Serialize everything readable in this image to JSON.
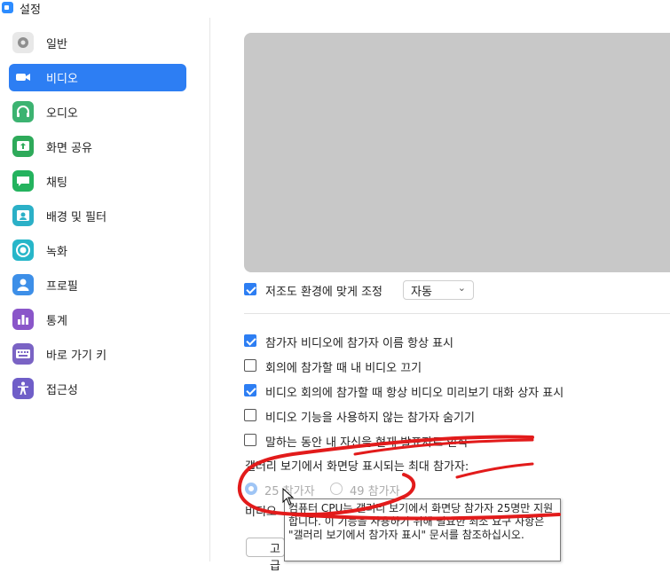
{
  "window": {
    "title": "설정"
  },
  "sidebar": {
    "items": [
      {
        "label": "일반",
        "icon": "gear-icon",
        "color": "#8f8f8f",
        "active": false
      },
      {
        "label": "비디오",
        "icon": "video-camera-icon",
        "color": "#2d7ef3",
        "active": true
      },
      {
        "label": "오디오",
        "icon": "headphones-icon",
        "color": "#3cb371",
        "active": false
      },
      {
        "label": "화면 공유",
        "icon": "share-screen-icon",
        "color": "#2eaa5a",
        "active": false
      },
      {
        "label": "채팅",
        "icon": "chat-icon",
        "color": "#24b35e",
        "active": false
      },
      {
        "label": "배경 및 필터",
        "icon": "background-icon",
        "color": "#2bb0c7",
        "active": false
      },
      {
        "label": "녹화",
        "icon": "record-icon",
        "color": "#27b6c9",
        "active": false
      },
      {
        "label": "프로필",
        "icon": "profile-icon",
        "color": "#3d8fe8",
        "active": false
      },
      {
        "label": "통계",
        "icon": "statistics-icon",
        "color": "#8a56c9",
        "active": false
      },
      {
        "label": "바로 가기 키",
        "icon": "keyboard-icon",
        "color": "#7a63c4",
        "active": false
      },
      {
        "label": "접근성",
        "icon": "accessibility-icon",
        "color": "#6f5ec8",
        "active": false
      }
    ]
  },
  "video": {
    "adjust_lighting": {
      "label": "저조도 환경에 맞게 조정",
      "checked": true
    },
    "lighting_select": {
      "value": "자동"
    },
    "options": [
      {
        "label": "참가자 비디오에 참가자 이름 항상 표시",
        "checked": true
      },
      {
        "label": "회의에 참가할 때 내 비디오 끄기",
        "checked": false
      },
      {
        "label": "비디오 회의에 참가할 때 항상 비디오 미리보기 대화 상자 표시",
        "checked": true
      },
      {
        "label": "비디오 기능을 사용하지 않는 참가자 숨기기",
        "checked": false
      },
      {
        "label": "말하는 동안 내 자신을 현재 발표자로 인식",
        "checked": false
      }
    ],
    "gallery_label": "갤러리 보기에서 화면당 표시되는 최대 참가자:",
    "radio_25": "25 참가자",
    "radio_49": "49 참가자",
    "partial_label": "비디오",
    "partial_button": "고급",
    "tooltip_text": "컴퓨터 CPU는 갤러리 보기에서 화면당 참가자 25명만 지원합니다. 이 기능을 사용하기 위해 필요한 최소 요구 사항은 \"갤러리 보기에서 참가자 표시\" 문서를 참조하십시오."
  }
}
